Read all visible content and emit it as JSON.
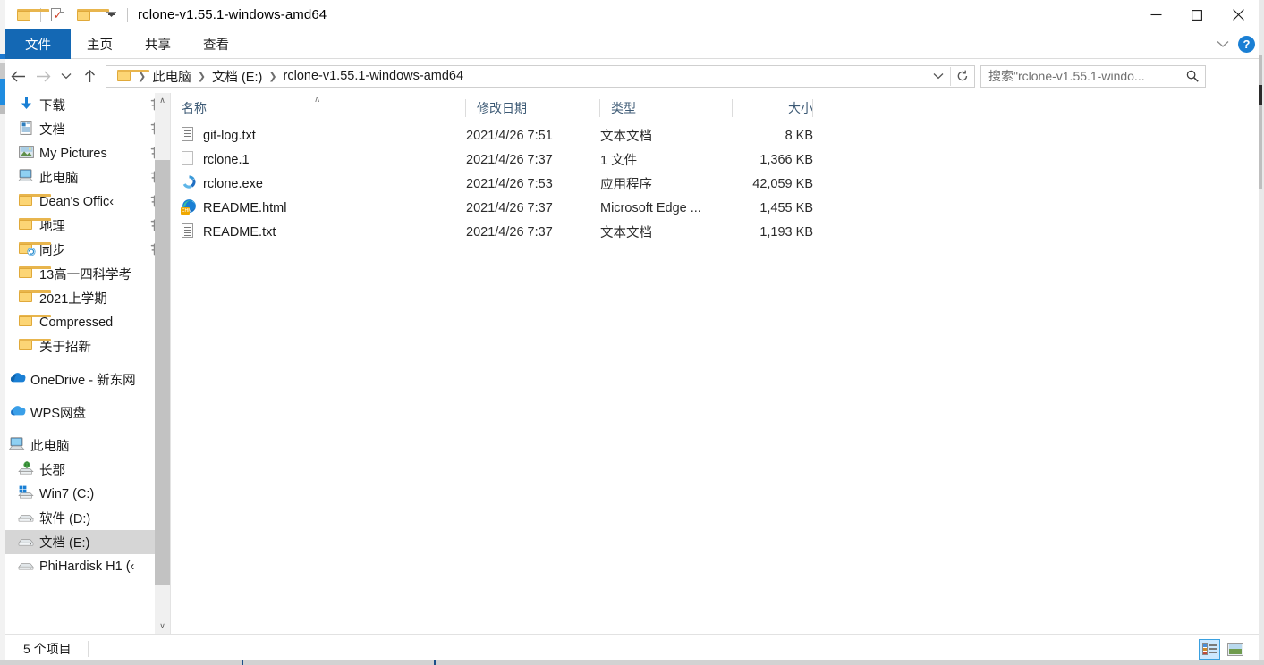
{
  "window": {
    "title": "rclone-v1.55.1-windows-amd64",
    "quick_access": [
      {
        "name": "folder-icon",
        "label": "文件夹"
      },
      {
        "name": "properties-icon",
        "label": "属性"
      },
      {
        "name": "new-folder-icon",
        "label": "新建文件夹"
      },
      {
        "name": "customize-qat-icon",
        "label": "自定义快速访问工具栏"
      }
    ],
    "controls": {
      "minimize": "—",
      "maximize": "☐",
      "close": "✕"
    }
  },
  "ribbon": {
    "tabs": [
      {
        "label": "文件",
        "active": true
      },
      {
        "label": "主页",
        "active": false
      },
      {
        "label": "共享",
        "active": false
      },
      {
        "label": "查看",
        "active": false
      }
    ],
    "collapse_label": "∨",
    "help_label": "?"
  },
  "addressbar": {
    "back_label": "←",
    "forward_label": "→",
    "recent_label": "∨",
    "up_label": "↑",
    "breadcrumbs": [
      "此电脑",
      "文档 (E:)",
      "rclone-v1.55.1-windows-amd64"
    ],
    "dropdown_label": "∨",
    "refresh_label": "↻"
  },
  "search": {
    "value": "搜索\"rclone-v1.55.1-windo...",
    "placeholder": "搜索\"rclone-v1.55.1-windows-amd64\"",
    "icon": "search-icon"
  },
  "sidebar": {
    "groups": [
      {
        "items": [
          {
            "label": "下载",
            "icon": "download-icon",
            "pinned": true,
            "indent": 1
          },
          {
            "label": "文档",
            "icon": "document-icon",
            "pinned": true,
            "indent": 1
          },
          {
            "label": "My Pictures",
            "icon": "pictures-icon",
            "pinned": true,
            "indent": 1
          },
          {
            "label": "此电脑",
            "icon": "this-pc-icon",
            "pinned": true,
            "indent": 1
          },
          {
            "label": "Dean's Offic‹",
            "icon": "folder-icon",
            "pinned": true,
            "indent": 1
          },
          {
            "label": "地理",
            "icon": "folder-icon",
            "pinned": true,
            "indent": 1
          },
          {
            "label": "同步",
            "icon": "folder-sync-icon",
            "pinned": true,
            "indent": 1
          },
          {
            "label": "13高一四科学考",
            "icon": "folder-icon",
            "pinned": false,
            "indent": 1
          },
          {
            "label": "2021上学期",
            "icon": "folder-icon",
            "pinned": false,
            "indent": 1
          },
          {
            "label": "Compressed",
            "icon": "folder-icon",
            "pinned": false,
            "indent": 1
          },
          {
            "label": "关于招新",
            "icon": "folder-icon",
            "pinned": false,
            "indent": 1
          }
        ]
      },
      {
        "items": [
          {
            "label": "OneDrive - 新东网",
            "icon": "onedrive-icon",
            "pinned": false,
            "indent": 0
          }
        ]
      },
      {
        "items": [
          {
            "label": "WPS网盘",
            "icon": "wps-cloud-icon",
            "pinned": false,
            "indent": 0
          }
        ]
      },
      {
        "items": [
          {
            "label": "此电脑",
            "icon": "this-pc-icon",
            "pinned": false,
            "indent": 0
          },
          {
            "label": "长郡",
            "icon": "network-drive-icon",
            "pinned": false,
            "indent": 1
          },
          {
            "label": "Win7 (C:)",
            "icon": "windows-drive-icon",
            "pinned": false,
            "indent": 1
          },
          {
            "label": "软件 (D:)",
            "icon": "drive-icon",
            "pinned": false,
            "indent": 1
          },
          {
            "label": "文档 (E:)",
            "icon": "drive-icon",
            "pinned": false,
            "indent": 1,
            "selected": true
          },
          {
            "label": "PhiHardisk H1 (‹",
            "icon": "drive-icon",
            "pinned": false,
            "indent": 1
          }
        ]
      }
    ],
    "scroll_up_label": "∧",
    "scroll_down_label": "∨"
  },
  "filelist": {
    "columns": [
      {
        "key": "name",
        "label": "名称",
        "sorted": "asc"
      },
      {
        "key": "date",
        "label": "修改日期"
      },
      {
        "key": "type",
        "label": "类型"
      },
      {
        "key": "size",
        "label": "大小"
      }
    ],
    "sort_caret": "∧",
    "rows": [
      {
        "name": "git-log.txt",
        "date": "2021/4/26 7:51",
        "type": "文本文档",
        "size": "8 KB",
        "icon": "text-file-icon"
      },
      {
        "name": "rclone.1",
        "date": "2021/4/26 7:37",
        "type": "1 文件",
        "size": "1,366 KB",
        "icon": "generic-file-icon"
      },
      {
        "name": "rclone.exe",
        "date": "2021/4/26 7:53",
        "type": "应用程序",
        "size": "42,059 KB",
        "icon": "rclone-app-icon"
      },
      {
        "name": "README.html",
        "date": "2021/4/26 7:37",
        "type": "Microsoft Edge ...",
        "size": "1,455 KB",
        "icon": "edge-html-icon"
      },
      {
        "name": "README.txt",
        "date": "2021/4/26 7:37",
        "type": "文本文档",
        "size": "1,193 KB",
        "icon": "text-file-icon"
      }
    ]
  },
  "statusbar": {
    "item_count": "5 个项目",
    "views": [
      {
        "name": "details-view-button",
        "label": "详细信息",
        "active": true
      },
      {
        "name": "large-icons-view-button",
        "label": "大图标",
        "active": false
      }
    ]
  },
  "colors": {
    "accent": "#1468b4",
    "selection": "#d6d6d6",
    "view_active": "#cce8ff",
    "column_header_text": "#3d5a75"
  }
}
